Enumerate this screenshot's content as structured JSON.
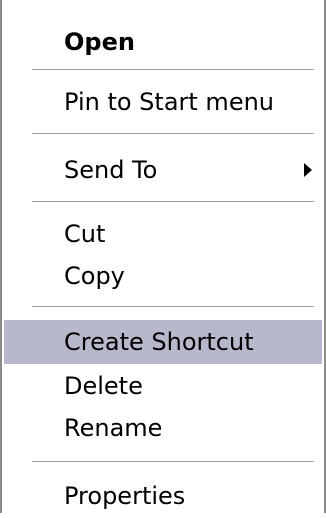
{
  "menu": {
    "items": {
      "open": "Open",
      "pin": "Pin to Start menu",
      "send_to": "Send To",
      "cut": "Cut",
      "copy": "Copy",
      "create_shortcut": "Create Shortcut",
      "delete": "Delete",
      "rename": "Rename",
      "properties": "Properties"
    },
    "highlighted_item": "Create Shortcut",
    "icons": {
      "submenu_arrow": "chevron-right-icon"
    },
    "colors": {
      "highlight": "#b8b8cc",
      "separator": "#9a9a9a",
      "border": "#8a8a8a"
    }
  }
}
